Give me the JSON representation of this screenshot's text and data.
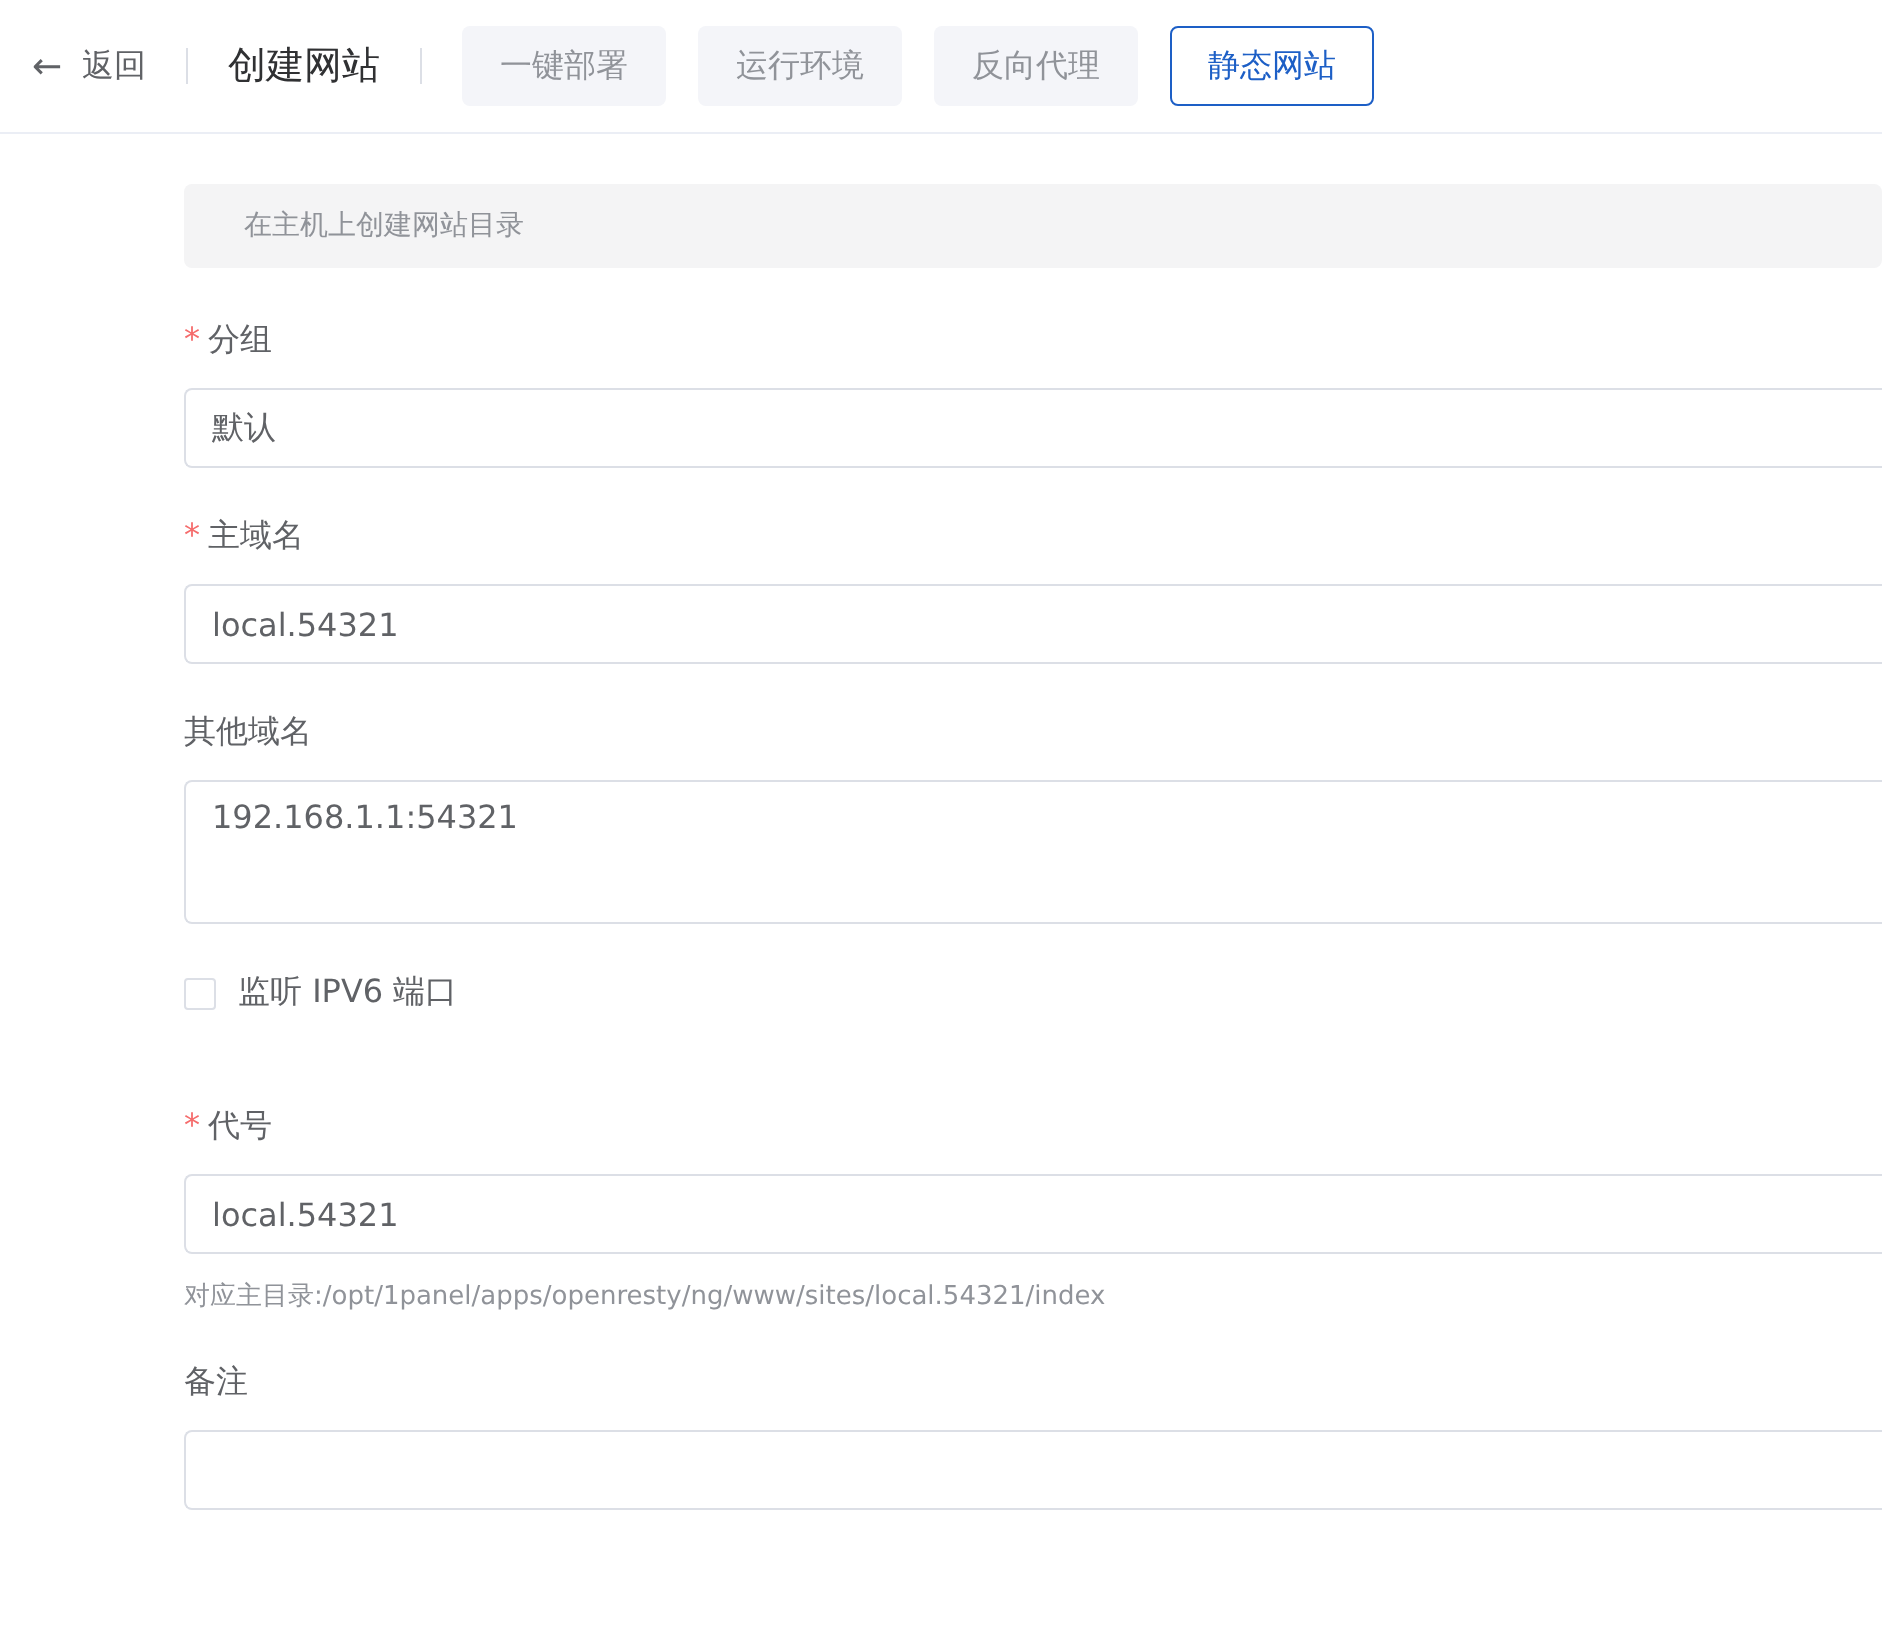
{
  "header": {
    "back": {
      "icon": "←",
      "label": "返回"
    },
    "title": "创建网站",
    "tabs": [
      {
        "label": "一键部署",
        "selected": false
      },
      {
        "label": "运行环境",
        "selected": false
      },
      {
        "label": "反向代理",
        "selected": false
      },
      {
        "label": "静态网站",
        "selected": true
      }
    ]
  },
  "notice": "在主机上创建网站目录",
  "fields": [
    {
      "kind": "select",
      "marker": "*",
      "label": "分组",
      "value": "默认"
    },
    {
      "kind": "input",
      "marker": "*",
      "label": "主域名",
      "value": "local.54321"
    },
    {
      "kind": "textarea",
      "label": "其他域名",
      "value": "192.168.1.1:54321"
    },
    {
      "kind": "checkbox",
      "label": "监听 IPV6 端口",
      "checked": false
    },
    {
      "kind": "input",
      "marker": "*",
      "label": "代号",
      "value": "local.54321",
      "hint": "对应主目录:/opt/1panel/apps/openresty/ng/www/sites/local.54321/index"
    },
    {
      "kind": "input",
      "label": "备注"
    }
  ]
}
